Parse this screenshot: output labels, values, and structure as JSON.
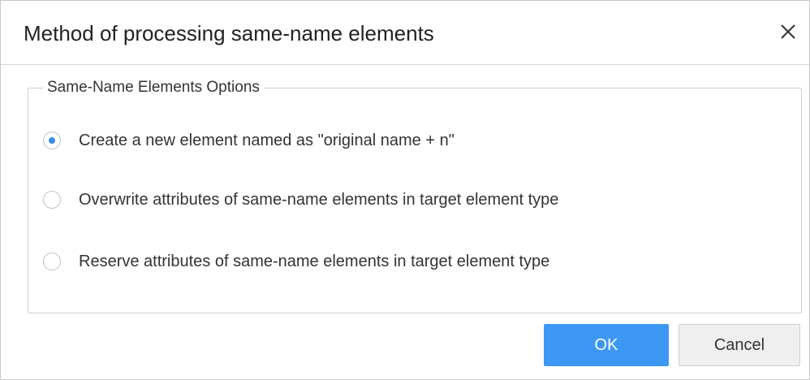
{
  "dialog": {
    "title": "Method of processing same-name elements",
    "close_icon": "close-icon"
  },
  "group": {
    "legend": "Same-Name Elements Options",
    "options": [
      {
        "label": "Create a new element named as \"original name + n\"",
        "checked": true
      },
      {
        "label": "Overwrite attributes of same-name elements in target element type",
        "checked": false
      },
      {
        "label": "Reserve attributes of same-name elements in target element type",
        "checked": false
      }
    ]
  },
  "buttons": {
    "ok_label": "OK",
    "cancel_label": "Cancel"
  },
  "colors": {
    "accent": "#3d98f5",
    "radio_dot": "#3a8ee6"
  }
}
